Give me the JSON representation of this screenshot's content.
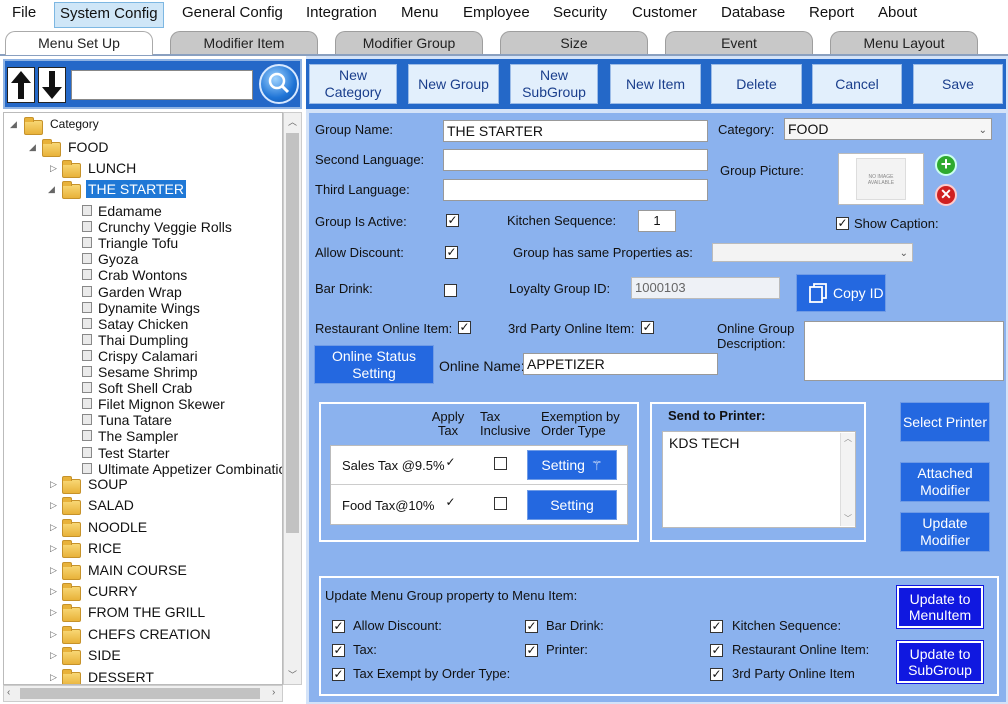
{
  "menubar": {
    "items": [
      "File",
      "System Config",
      "General Config",
      "Integration",
      "Menu",
      "Employee",
      "Security",
      "Customer",
      "Database",
      "Report",
      "About"
    ],
    "active": "System Config"
  },
  "tabs": [
    "Menu Set Up",
    "Modifier Item",
    "Modifier Group",
    "Size",
    "Event",
    "Menu Layout"
  ],
  "search": {
    "value": ""
  },
  "tree": {
    "root": "Category",
    "food": "FOOD",
    "lunch": "LUNCH",
    "selected": "THE STARTER",
    "items": [
      "Edamame",
      "Crunchy Veggie Rolls",
      "Triangle Tofu",
      "Gyoza",
      "Crab Wontons",
      "Garden Wrap",
      "Dynamite Wings",
      "Satay Chicken",
      "Thai Dumpling",
      "Crispy Calamari",
      "Sesame Shrimp",
      "Soft Shell Crab",
      "Filet Mignon Skewer",
      "Tuna Tatare",
      "The Sampler",
      "Test Starter",
      "Ultimate Appetizer Combinatic"
    ],
    "groups": [
      "SOUP",
      "SALAD",
      "NOODLE",
      "RICE",
      "MAIN COURSE",
      "CURRY",
      "FROM THE GRILL",
      "CHEFS CREATION",
      "SIDE",
      "DESSERT"
    ]
  },
  "toolbar": {
    "new_category": "New Category",
    "new_group": "New Group",
    "new_subgroup": "New SubGroup",
    "new_item": "New Item",
    "delete": "Delete",
    "cancel": "Cancel",
    "save": "Save"
  },
  "form": {
    "group_name_label": "Group Name:",
    "group_name": "THE STARTER",
    "second_language_label": "Second Language:",
    "second_language": "",
    "third_language_label": "Third Language:",
    "third_language": "",
    "category_label": "Category:",
    "category": "FOOD",
    "group_picture_label": "Group Picture:",
    "no_image": "NO IMAGE AVAILABLE",
    "show_caption_label": "Show Caption:",
    "group_active_label": "Group Is Active:",
    "kitchen_sequence_label": "Kitchen Sequence:",
    "kitchen_sequence": "1",
    "allow_discount_label": "Allow Discount:",
    "same_properties_label": "Group has same Properties as:",
    "same_properties": "",
    "bar_drink_label": "Bar Drink:",
    "loyalty_label": "Loyalty Group ID:",
    "loyalty_id": "1000103",
    "copy_id": "Copy ID",
    "restaurant_online_label": "Restaurant Online Item:",
    "third_party_label": "3rd Party Online Item:",
    "online_desc_label": "Online Group Description:",
    "online_desc": "",
    "online_status_btn": "Online Status Setting",
    "online_name_label": "Online Name:",
    "online_name": "APPETIZER"
  },
  "tax": {
    "col_apply": "Apply Tax",
    "col_inclusive": "Tax Inclusive",
    "col_exemption": "Exemption by Order Type",
    "rows": [
      {
        "name": "Sales Tax @9.5%",
        "apply": true,
        "inclusive": false,
        "btn": "Setting"
      },
      {
        "name": "Food Tax@10%",
        "apply": true,
        "inclusive": false,
        "btn": "Setting"
      }
    ]
  },
  "printer": {
    "title": "Send to Printer:",
    "items": [
      "KDS TECH"
    ],
    "select_btn": "Select Printer",
    "attached_btn": "Attached Modifier",
    "update_btn": "Update Modifier"
  },
  "update": {
    "title": "Update Menu Group property to Menu Item:",
    "allow_discount": "Allow Discount:",
    "tax": "Tax:",
    "tax_exempt": "Tax Exempt by Order Type:",
    "bar_drink": "Bar Drink:",
    "printer": "Printer:",
    "kitchen_seq": "Kitchen Sequence:",
    "restaurant_online": "Restaurant Online Item:",
    "third_party": "3rd Party Online Item",
    "to_menuitem": "Update to MenuItem",
    "to_subgroup": "Update to SubGroup"
  },
  "colors": {
    "toolbar": "#2468c8",
    "form_bg": "#8bb2ee",
    "button_blue": "#2468e0",
    "navy": "#1018e0"
  }
}
